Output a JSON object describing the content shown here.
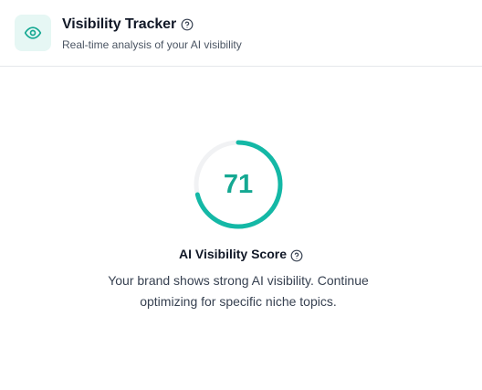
{
  "header": {
    "icon": "eye-icon",
    "title": "Visibility Tracker",
    "subtitle": "Real-time analysis of your AI visibility",
    "help_icon": "question-circle-icon"
  },
  "score": {
    "value": "71",
    "fraction": 0.71,
    "label": "AI Visibility Score",
    "help_icon": "question-circle-icon",
    "description": "Your brand shows strong AI visibility. Continue optimizing for specific niche topics."
  },
  "colors": {
    "accent": "#14b8a6",
    "accent_text": "#14a892",
    "track": "#f1f2f4",
    "icon_bg": "#e6f7f4"
  }
}
